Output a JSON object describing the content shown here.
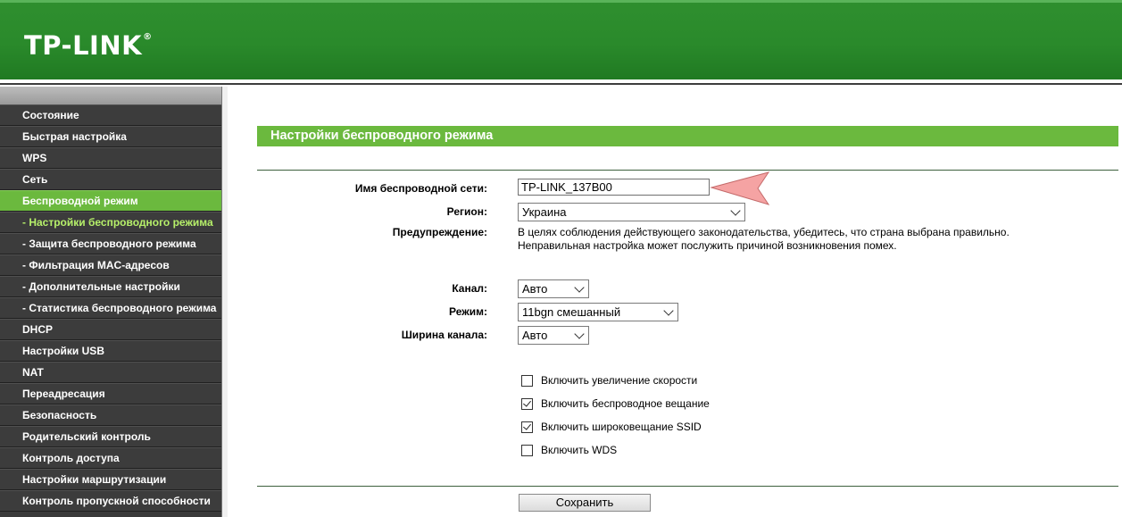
{
  "header": {
    "logo": "TP-LINK",
    "logo_mark": "®"
  },
  "sidebar": {
    "items": [
      {
        "label": "Состояние"
      },
      {
        "label": "Быстрая настройка"
      },
      {
        "label": "WPS"
      },
      {
        "label": "Сеть"
      },
      {
        "label": "Беспроводной режим"
      },
      {
        "label": "- Настройки беспроводного режима"
      },
      {
        "label": "- Защита беспроводного режима"
      },
      {
        "label": "- Фильтрация MAC-адресов"
      },
      {
        "label": "- Дополнительные настройки"
      },
      {
        "label": "- Статистика беспроводного режима"
      },
      {
        "label": "DHCP"
      },
      {
        "label": "Настройки USB"
      },
      {
        "label": "NAT"
      },
      {
        "label": "Переадресация"
      },
      {
        "label": "Безопасность"
      },
      {
        "label": "Родительский контроль"
      },
      {
        "label": "Контроль доступа"
      },
      {
        "label": "Настройки маршрутизации"
      },
      {
        "label": "Контроль пропускной способности"
      }
    ]
  },
  "main": {
    "title": "Настройки беспроводного режима",
    "ssid_label": "Имя беспроводной сети:",
    "ssid_value": "TP-LINK_137B00",
    "region_label": "Регион:",
    "region_value": "Украина",
    "warning_label": "Предупреждение:",
    "warning_line1": "В целях соблюдения действующего законодательства, убедитесь, что страна выбрана правильно.",
    "warning_line2": "Неправильная настройка может послужить причиной возникновения помех.",
    "channel_label": "Канал:",
    "channel_value": "Авто",
    "mode_label": "Режим:",
    "mode_value": "11bgn смешанный",
    "width_label": "Ширина канала:",
    "width_value": "Авто",
    "checkboxes": [
      {
        "label": "Включить увеличение скорости",
        "checked": false
      },
      {
        "label": "Включить беспроводное вещание",
        "checked": true
      },
      {
        "label": "Включить широковещание SSID",
        "checked": true
      },
      {
        "label": "Включить WDS",
        "checked": false
      }
    ],
    "save_label": "Сохранить"
  },
  "colors": {
    "header_green": "#2a8a2b",
    "accent_green": "#6bb93e",
    "sidebar_bg": "#3c3c3c",
    "pointer": "#f5a3a3"
  }
}
